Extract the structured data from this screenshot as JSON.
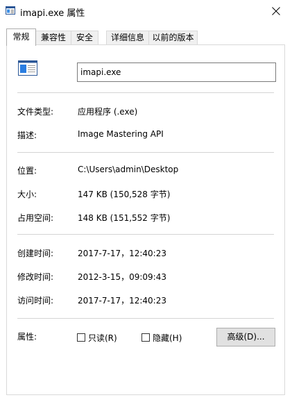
{
  "window": {
    "title": "imapi.exe 属性"
  },
  "tabs": [
    {
      "label": "常规"
    },
    {
      "label": "兼容性"
    },
    {
      "label": "安全"
    },
    {
      "label": "详细信息"
    },
    {
      "label": "以前的版本"
    }
  ],
  "general": {
    "file_name": "imapi.exe",
    "file_type": {
      "label": "文件类型:",
      "value": "应用程序 (.exe)"
    },
    "description": {
      "label": "描述:",
      "value": "Image Mastering API"
    },
    "location": {
      "label": "位置:",
      "value": "C:\\Users\\admin\\Desktop"
    },
    "size": {
      "label": "大小:",
      "value": "147 KB (150,528 字节)"
    },
    "size_on_disk": {
      "label": "占用空间:",
      "value": "148 KB (151,552 字节)"
    },
    "created": {
      "label": "创建时间:",
      "value": "2017-7-17，12:40:23"
    },
    "modified": {
      "label": "修改时间:",
      "value": "2012-3-15，09:09:43"
    },
    "accessed": {
      "label": "访问时间:",
      "value": "2017-7-17，12:40:23"
    },
    "attributes": {
      "label": "属性:",
      "readonly_label": "只读(R)",
      "readonly_checked": false,
      "hidden_label": "隐藏(H)",
      "hidden_checked": false,
      "advanced_label": "高级(D)..."
    }
  }
}
